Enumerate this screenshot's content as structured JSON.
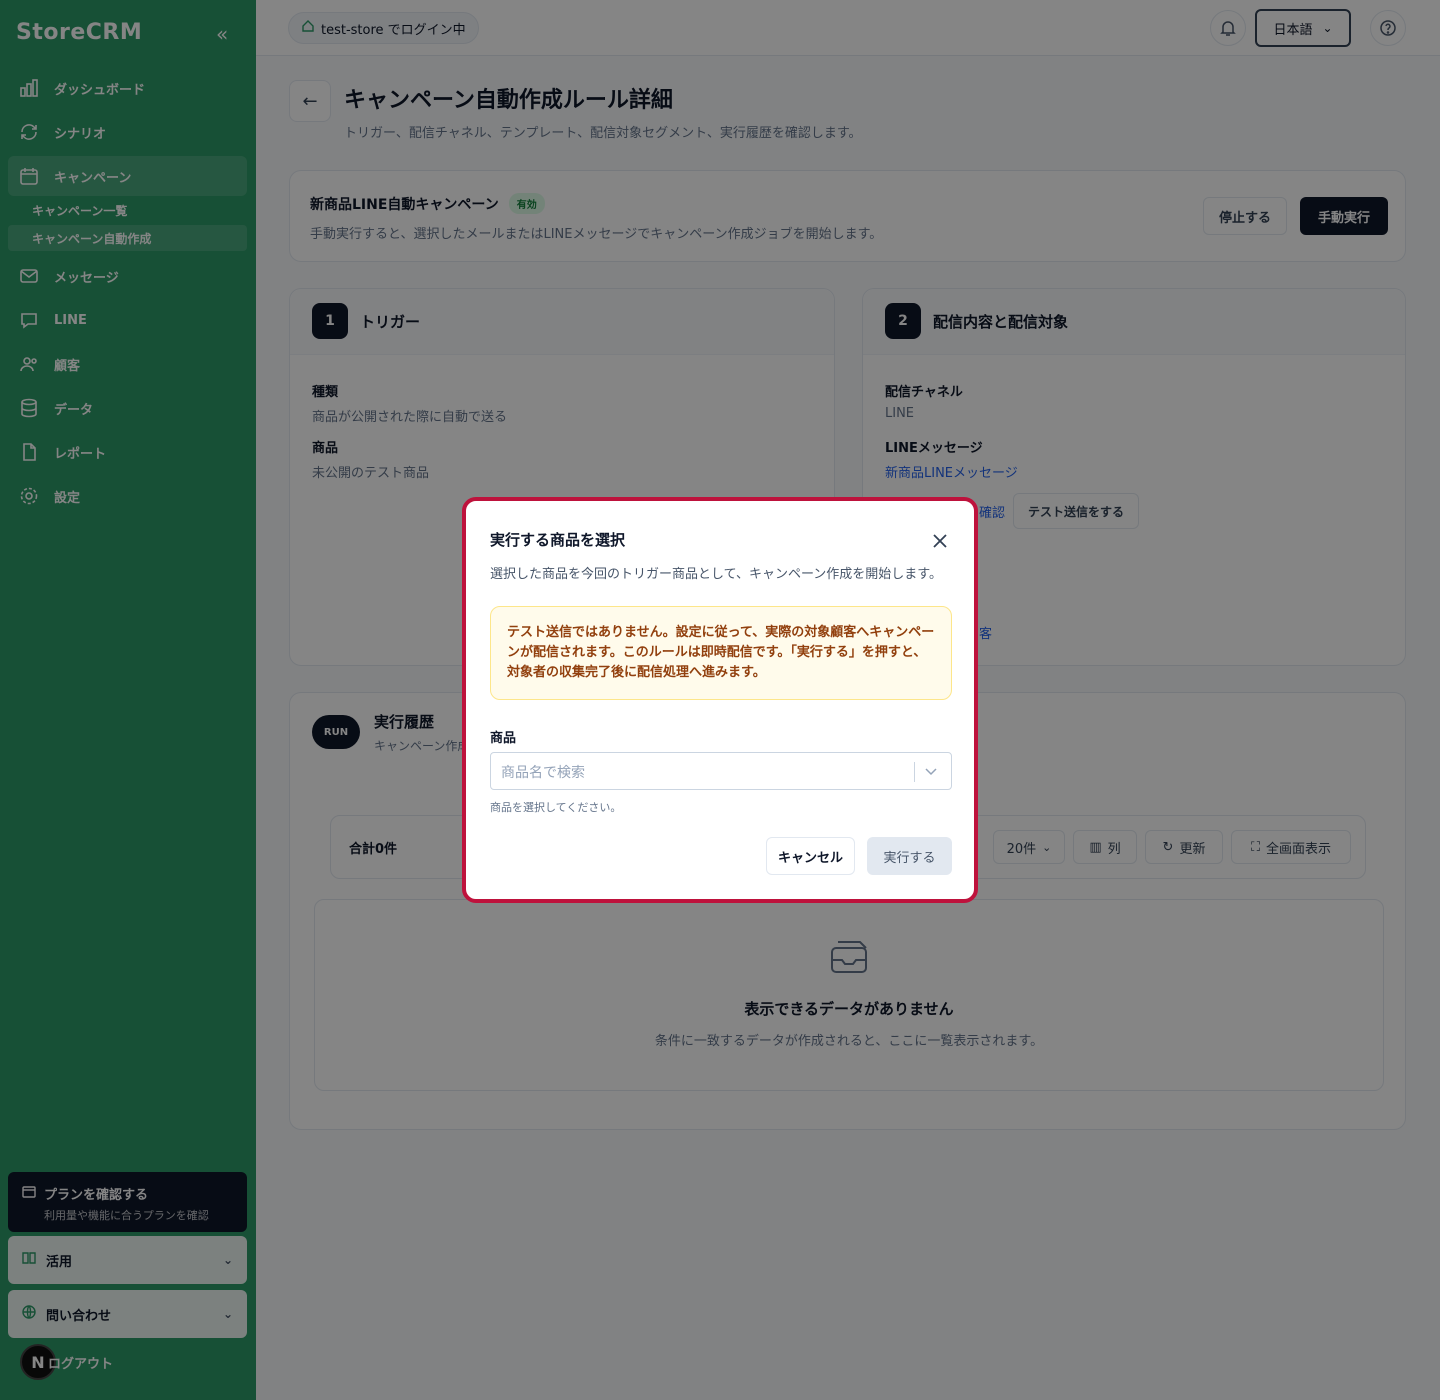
{
  "sidebar": {
    "logo": "StoreCRM",
    "nav": [
      {
        "label": "ダッシュボード"
      },
      {
        "label": "シナリオ"
      },
      {
        "label": "キャンペーン"
      },
      {
        "label": "メッセージ"
      },
      {
        "label": "LINE"
      },
      {
        "label": "顧客"
      },
      {
        "label": "データ"
      },
      {
        "label": "レポート"
      },
      {
        "label": "設定"
      }
    ],
    "sub": [
      {
        "label": "キャンペーン一覧"
      },
      {
        "label": "キャンペーン自動作成"
      }
    ],
    "plan": {
      "title": "プランを確認する",
      "sub": "利用量や機能に合うプランを確認"
    },
    "usage": "活用",
    "contact": "問い合わせ",
    "logout": "ログアウト",
    "next_badge": "N"
  },
  "topbar": {
    "store": "test-store でログイン中",
    "language": "日本語"
  },
  "page": {
    "title": "キャンペーン自動作成ルール詳細",
    "subtitle": "トリガー、配信チャネル、テンプレート、配信対象セグメント、実行履歴を確認します。"
  },
  "rule": {
    "name": "新商品LINE自動キャンペーン",
    "status": "有効",
    "desc": "手動実行すると、選択したメールまたはLINEメッセージでキャンペーン作成ジョブを開始します。",
    "stop_label": "停止する",
    "run_label": "手動実行"
  },
  "trigger": {
    "num": "1",
    "title": "トリガー",
    "type_label": "種類",
    "type_value": "商品が公開された際に自動で送る",
    "product_label": "商品",
    "product_value": "未公開のテスト商品"
  },
  "delivery": {
    "num": "2",
    "title": "配信内容と配信対象",
    "channel_label": "配信チャネル",
    "channel_value": "LINE",
    "message_label": "LINEメッセージ",
    "message_value": "新商品LINEメッセージ",
    "confirm_fragment": "確認",
    "test_send": "テスト送信をする",
    "segment_fragment": "客"
  },
  "history": {
    "badge": "RUN",
    "title": "実行履歴",
    "sub": "キャンペーン作成",
    "total": "合計0件",
    "per_page": "20件",
    "columns": "列",
    "refresh": "更新",
    "fullscreen": "全画面表示",
    "empty_title": "表示できるデータがありません",
    "empty_sub": "条件に一致するデータが作成されると、ここに一覧表示されます。"
  },
  "modal": {
    "title": "実行する商品を選択",
    "desc": "選択した商品を今回のトリガー商品として、キャンペーン作成を開始します。",
    "warning": "テスト送信ではありません。設定に従って、実際の対象顧客へキャンペーンが配信されます。このルールは即時配信です。「実行する」を押すと、対象者の収集完了後に配信処理へ進みます。",
    "field_label": "商品",
    "placeholder": "商品名で検索",
    "help": "商品を選択してください。",
    "cancel": "キャンセル",
    "run": "実行する"
  },
  "colors": {
    "sidebar": "#2d9a68",
    "dark": "#0f172a",
    "modal_border": "#be123c",
    "warning_bg": "#fffbeb",
    "link": "#2563eb"
  }
}
